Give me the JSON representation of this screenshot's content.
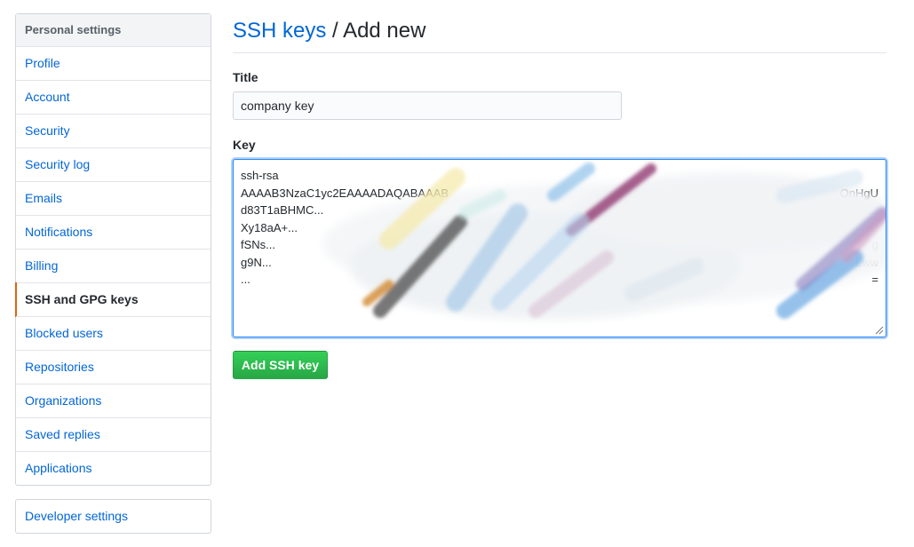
{
  "sidebar": {
    "heading": "Personal settings",
    "items": [
      {
        "label": "Profile"
      },
      {
        "label": "Account"
      },
      {
        "label": "Security"
      },
      {
        "label": "Security log"
      },
      {
        "label": "Emails"
      },
      {
        "label": "Notifications"
      },
      {
        "label": "Billing"
      },
      {
        "label": "SSH and GPG keys",
        "selected": true
      },
      {
        "label": "Blocked users"
      },
      {
        "label": "Repositories"
      },
      {
        "label": "Organizations"
      },
      {
        "label": "Saved replies"
      },
      {
        "label": "Applications"
      }
    ],
    "developer_settings": "Developer settings"
  },
  "main": {
    "breadcrumb_link": "SSH keys",
    "breadcrumb_separator": "/",
    "page_title": "Add new",
    "title_label": "Title",
    "title_value": "company key",
    "key_label": "Key",
    "key_visible_lines": [
      "ssh-rsa",
      "AAAAB3NzaC1yc2EAAAADAQABAAAB",
      "d83T1aBHMC...",
      "Xy18aA+...",
      "fSNs...",
      "g9N...",
      "..."
    ],
    "key_visible_line_ends": [
      "",
      "OnHgU",
      "...",
      "...",
      "g",
      "Lww",
      "="
    ],
    "submit_label": "Add SSH key"
  },
  "colors": {
    "link": "#0366d6",
    "selected_indicator": "#e36209",
    "button_green": "#28a745",
    "focus_border": "#2188ff"
  }
}
